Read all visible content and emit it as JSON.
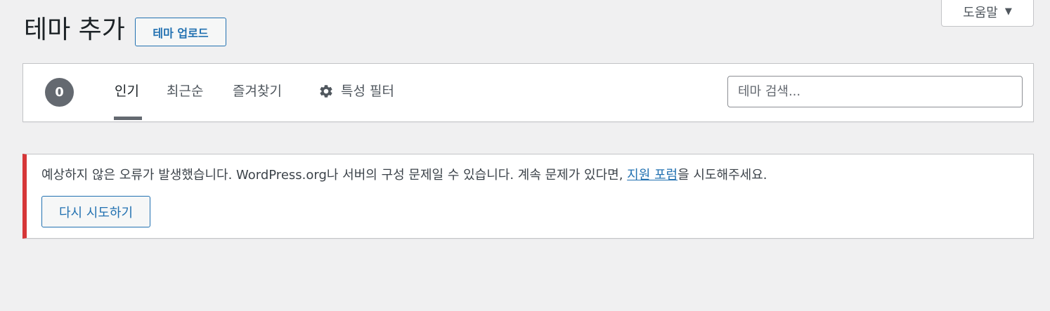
{
  "help": {
    "label": "도움말",
    "caret": "▼"
  },
  "header": {
    "title": "테마 추가",
    "upload_label": "테마 업로드"
  },
  "filter_bar": {
    "count": "0",
    "tabs": [
      {
        "label": "인기",
        "active": true
      },
      {
        "label": "최근순",
        "active": false
      },
      {
        "label": "즐겨찾기",
        "active": false
      }
    ],
    "feature_filter_label": "특성 필터",
    "search_placeholder": "테마 검색..."
  },
  "notice": {
    "text_before": "예상하지 않은 오류가 발생했습니다. WordPress.org나 서버의 구성 문제일 수 있습니다. 계속 문제가 있다면, ",
    "link_text": "지원 포럼",
    "text_after": "을 시도해주세요.",
    "retry_label": "다시 시도하기"
  },
  "colors": {
    "accent": "#2271b1",
    "error": "#d63638",
    "background": "#f0f0f1"
  }
}
